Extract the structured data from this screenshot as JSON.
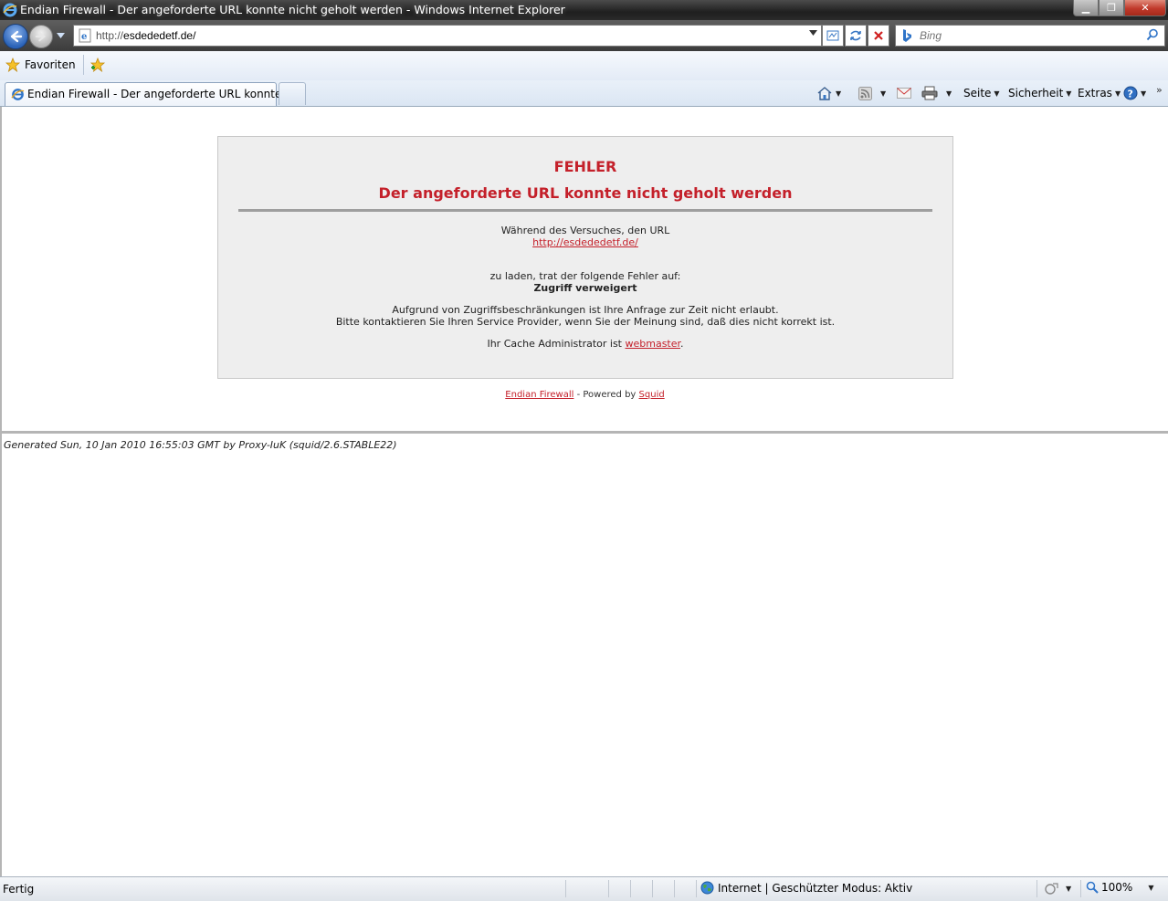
{
  "window": {
    "title": "Endian Firewall - Der angeforderte URL konnte nicht geholt werden - Windows Internet Explorer",
    "minimize_label": "▁",
    "maximize_label": "❐",
    "close_label": "✕"
  },
  "address": {
    "protocol": "http://",
    "host": "esdededetf.de/",
    "search_placeholder": "Bing"
  },
  "favorites": {
    "label": "Favoriten"
  },
  "tab": {
    "label": "Endian Firewall - Der angeforderte URL konnte ni..."
  },
  "command_bar": {
    "page": "Seite",
    "security": "Sicherheit",
    "extras": "Extras"
  },
  "page": {
    "error_title": "FEHLER",
    "error_heading": "Der angeforderte URL konnte nicht geholt werden",
    "while_trying": "Während des Versuches, den URL",
    "requested_url": "http://esdededetf.de/",
    "to_load": "zu laden, trat der folgende Fehler auf:",
    "error_name": "Zugriff verweigert",
    "explanation_1": "Aufgrund von Zugriffsbeschränkungen ist Ihre Anfrage zur Zeit nicht erlaubt.",
    "explanation_2": "Bitte kontaktieren Sie Ihren Service Provider, wenn Sie der Meinung sind, daß dies nicht korrekt ist.",
    "admin_prefix": "Ihr Cache Administrator ist ",
    "admin_link": "webmaster",
    "admin_suffix": ".",
    "footer_link_1": "Endian Firewall",
    "footer_middle": " - Powered by ",
    "footer_link_2": "Squid",
    "generated": "Generated Sun, 10 Jan 2010 16:55:03 GMT by Proxy-IuK (squid/2.6.STABLE22)"
  },
  "status": {
    "text": "Fertig",
    "zone": "Internet | Geschützter Modus: Aktiv",
    "zoom": "100%"
  },
  "colors": {
    "error_red": "#c4202a",
    "box_background": "#eeeeee"
  }
}
